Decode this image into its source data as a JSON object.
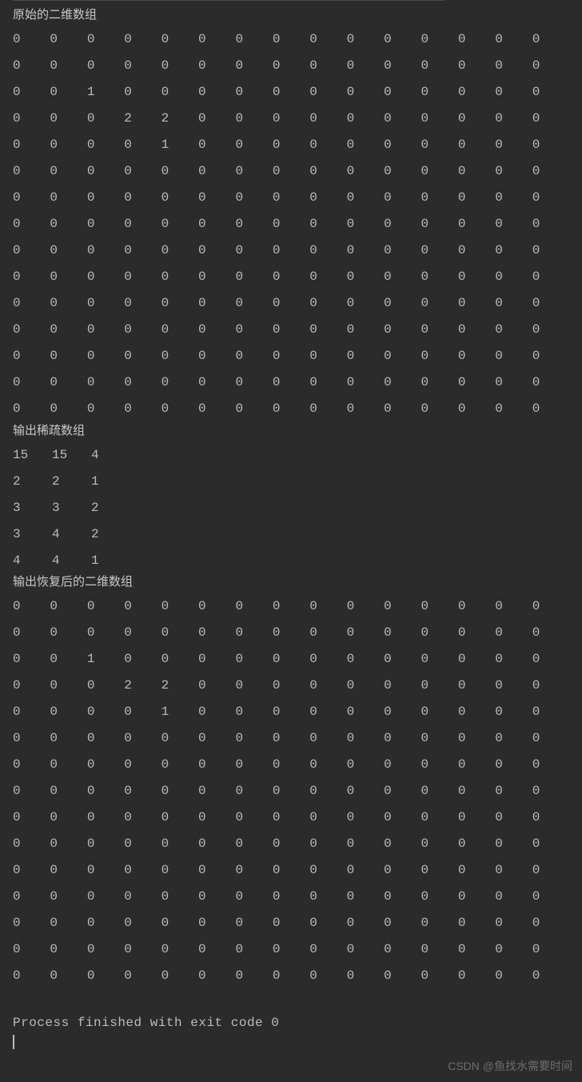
{
  "section1_title": "原始的二维数组",
  "matrix1": [
    [
      0,
      0,
      0,
      0,
      0,
      0,
      0,
      0,
      0,
      0,
      0,
      0,
      0,
      0,
      0
    ],
    [
      0,
      0,
      0,
      0,
      0,
      0,
      0,
      0,
      0,
      0,
      0,
      0,
      0,
      0,
      0
    ],
    [
      0,
      0,
      1,
      0,
      0,
      0,
      0,
      0,
      0,
      0,
      0,
      0,
      0,
      0,
      0
    ],
    [
      0,
      0,
      0,
      2,
      2,
      0,
      0,
      0,
      0,
      0,
      0,
      0,
      0,
      0,
      0
    ],
    [
      0,
      0,
      0,
      0,
      1,
      0,
      0,
      0,
      0,
      0,
      0,
      0,
      0,
      0,
      0
    ],
    [
      0,
      0,
      0,
      0,
      0,
      0,
      0,
      0,
      0,
      0,
      0,
      0,
      0,
      0,
      0
    ],
    [
      0,
      0,
      0,
      0,
      0,
      0,
      0,
      0,
      0,
      0,
      0,
      0,
      0,
      0,
      0
    ],
    [
      0,
      0,
      0,
      0,
      0,
      0,
      0,
      0,
      0,
      0,
      0,
      0,
      0,
      0,
      0
    ],
    [
      0,
      0,
      0,
      0,
      0,
      0,
      0,
      0,
      0,
      0,
      0,
      0,
      0,
      0,
      0
    ],
    [
      0,
      0,
      0,
      0,
      0,
      0,
      0,
      0,
      0,
      0,
      0,
      0,
      0,
      0,
      0
    ],
    [
      0,
      0,
      0,
      0,
      0,
      0,
      0,
      0,
      0,
      0,
      0,
      0,
      0,
      0,
      0
    ],
    [
      0,
      0,
      0,
      0,
      0,
      0,
      0,
      0,
      0,
      0,
      0,
      0,
      0,
      0,
      0
    ],
    [
      0,
      0,
      0,
      0,
      0,
      0,
      0,
      0,
      0,
      0,
      0,
      0,
      0,
      0,
      0
    ],
    [
      0,
      0,
      0,
      0,
      0,
      0,
      0,
      0,
      0,
      0,
      0,
      0,
      0,
      0,
      0
    ],
    [
      0,
      0,
      0,
      0,
      0,
      0,
      0,
      0,
      0,
      0,
      0,
      0,
      0,
      0,
      0
    ]
  ],
  "section2_title": "输出稀疏数组",
  "sparse": [
    [
      15,
      15,
      4
    ],
    [
      2,
      2,
      1
    ],
    [
      3,
      3,
      2
    ],
    [
      3,
      4,
      2
    ],
    [
      4,
      4,
      1
    ]
  ],
  "section3_title": "输出恢复后的二维数组",
  "matrix2": [
    [
      0,
      0,
      0,
      0,
      0,
      0,
      0,
      0,
      0,
      0,
      0,
      0,
      0,
      0,
      0
    ],
    [
      0,
      0,
      0,
      0,
      0,
      0,
      0,
      0,
      0,
      0,
      0,
      0,
      0,
      0,
      0
    ],
    [
      0,
      0,
      1,
      0,
      0,
      0,
      0,
      0,
      0,
      0,
      0,
      0,
      0,
      0,
      0
    ],
    [
      0,
      0,
      0,
      2,
      2,
      0,
      0,
      0,
      0,
      0,
      0,
      0,
      0,
      0,
      0
    ],
    [
      0,
      0,
      0,
      0,
      1,
      0,
      0,
      0,
      0,
      0,
      0,
      0,
      0,
      0,
      0
    ],
    [
      0,
      0,
      0,
      0,
      0,
      0,
      0,
      0,
      0,
      0,
      0,
      0,
      0,
      0,
      0
    ],
    [
      0,
      0,
      0,
      0,
      0,
      0,
      0,
      0,
      0,
      0,
      0,
      0,
      0,
      0,
      0
    ],
    [
      0,
      0,
      0,
      0,
      0,
      0,
      0,
      0,
      0,
      0,
      0,
      0,
      0,
      0,
      0
    ],
    [
      0,
      0,
      0,
      0,
      0,
      0,
      0,
      0,
      0,
      0,
      0,
      0,
      0,
      0,
      0
    ],
    [
      0,
      0,
      0,
      0,
      0,
      0,
      0,
      0,
      0,
      0,
      0,
      0,
      0,
      0,
      0
    ],
    [
      0,
      0,
      0,
      0,
      0,
      0,
      0,
      0,
      0,
      0,
      0,
      0,
      0,
      0,
      0
    ],
    [
      0,
      0,
      0,
      0,
      0,
      0,
      0,
      0,
      0,
      0,
      0,
      0,
      0,
      0,
      0
    ],
    [
      0,
      0,
      0,
      0,
      0,
      0,
      0,
      0,
      0,
      0,
      0,
      0,
      0,
      0,
      0
    ],
    [
      0,
      0,
      0,
      0,
      0,
      0,
      0,
      0,
      0,
      0,
      0,
      0,
      0,
      0,
      0
    ],
    [
      0,
      0,
      0,
      0,
      0,
      0,
      0,
      0,
      0,
      0,
      0,
      0,
      0,
      0,
      0
    ]
  ],
  "exit_message": "Process finished with exit code 0",
  "watermark": "CSDN @鱼找水需要时间"
}
